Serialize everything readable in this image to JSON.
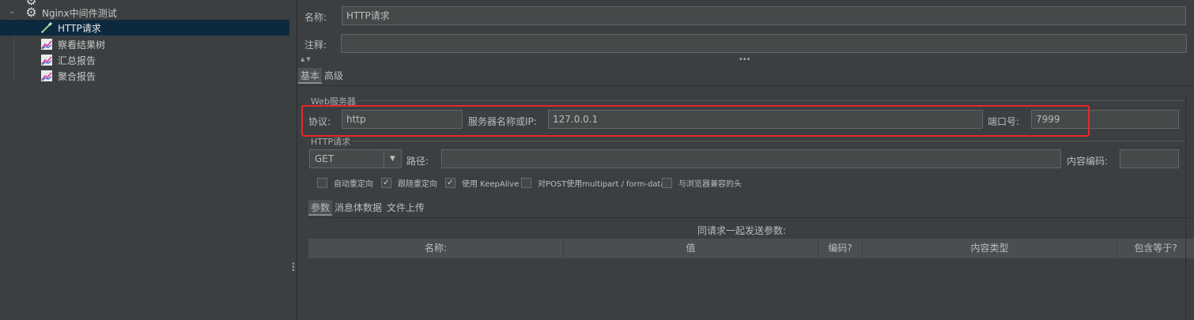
{
  "tree": {
    "items": [
      {
        "label": "Nginx中间件测试",
        "icon": "gear-icon",
        "expanded": true
      },
      {
        "label": "HTTP请求",
        "icon": "pipette-icon",
        "selected": true
      },
      {
        "label": "察看结果树",
        "icon": "chart-icon"
      },
      {
        "label": "汇总报告",
        "icon": "chart-icon"
      },
      {
        "label": "聚合报告",
        "icon": "chart-icon"
      }
    ]
  },
  "form": {
    "name_label": "名称:",
    "name_value": "HTTP请求",
    "comment_label": "注释:",
    "comment_value": ""
  },
  "tabs": [
    "基本",
    "高级"
  ],
  "web_server": {
    "group_title": "Web服务器",
    "protocol_label": "协议:",
    "protocol_value": "http",
    "server_label": "服务器名称或IP:",
    "server_value": "127.0.0.1",
    "port_label": "端口号:",
    "port_value": "7999"
  },
  "http_request": {
    "group_title": "HTTP请求",
    "method": "GET",
    "path_label": "路径:",
    "path_value": "",
    "encoding_label": "内容编码:",
    "encoding_value": ""
  },
  "checkboxes": [
    {
      "label": "自动重定向",
      "checked": false
    },
    {
      "label": "跟随重定向",
      "checked": true
    },
    {
      "label": "使用 KeepAlive",
      "checked": true
    },
    {
      "label": "对POST使用multipart / form-data",
      "checked": false
    },
    {
      "label": "与浏览器兼容的头",
      "checked": false
    }
  ],
  "sub_tabs": [
    "参数",
    "消息体数据",
    "文件上传"
  ],
  "params": {
    "caption": "同请求一起发送参数:",
    "columns": [
      "名称:",
      "值",
      "编码?",
      "内容类型",
      "包含等于?"
    ]
  },
  "colors": {
    "highlight": "#e8262a",
    "selected_row": "#0d293e",
    "background": "#3c3f41"
  }
}
